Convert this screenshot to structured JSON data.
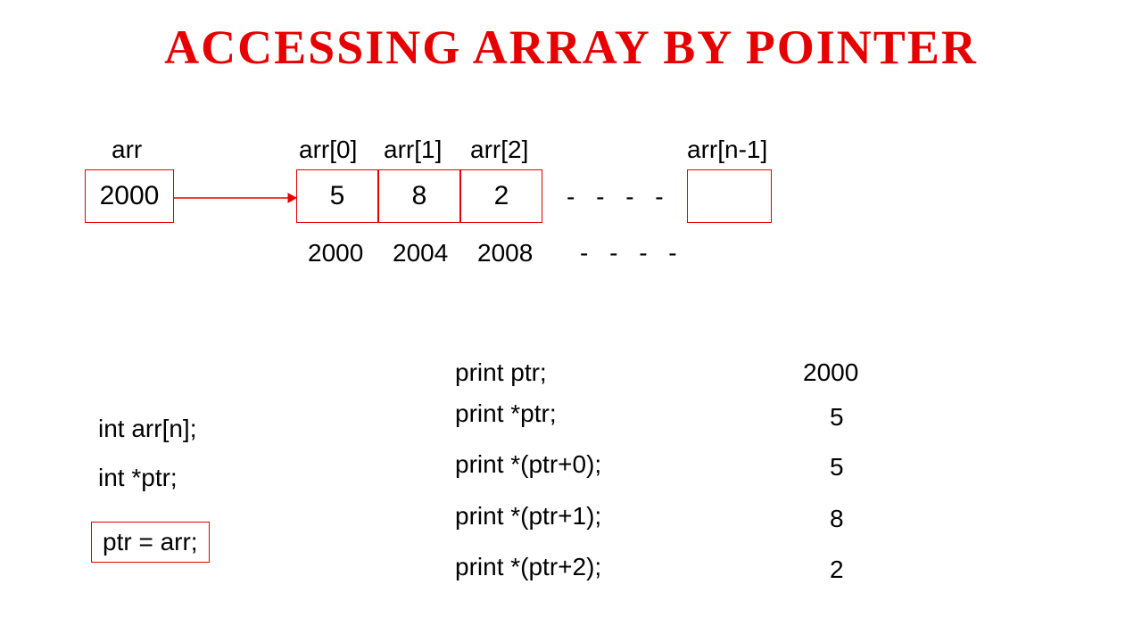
{
  "title": "ACCESSING ARRAY BY POINTER",
  "arr_label": "arr",
  "arr_box_value": "2000",
  "cells": [
    {
      "label": "arr[0]",
      "value": "5",
      "addr": "2000"
    },
    {
      "label": "arr[1]",
      "value": "8",
      "addr": "2004"
    },
    {
      "label": "arr[2]",
      "value": "2",
      "addr": "2008"
    }
  ],
  "dashes_mid": "- - - -",
  "last_label": "arr[n-1]",
  "dashes_addr": "- - - -",
  "code": {
    "line1": "int arr[n];",
    "line2": "int *ptr;",
    "line3": "ptr = arr;"
  },
  "outputs": [
    {
      "stmt": "print ptr;",
      "val": "2000"
    },
    {
      "stmt": "print *ptr;",
      "val": "5"
    },
    {
      "stmt": "print *(ptr+0);",
      "val": "5"
    },
    {
      "stmt": "print *(ptr+1);",
      "val": "8"
    },
    {
      "stmt": "print *(ptr+2);",
      "val": "2"
    }
  ]
}
